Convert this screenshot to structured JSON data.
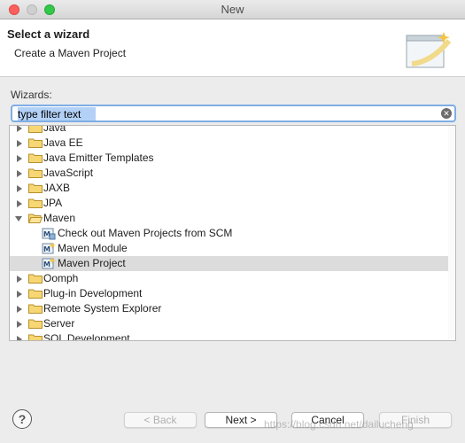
{
  "window": {
    "title": "New"
  },
  "header": {
    "title": "Select a wizard",
    "description": "Create a Maven Project"
  },
  "wizards": {
    "label": "Wizards:",
    "filter_value": "type filter text"
  },
  "tree": {
    "items": [
      {
        "label": "Java",
        "state": "collapsed",
        "kind": "folder"
      },
      {
        "label": "Java EE",
        "state": "collapsed",
        "kind": "folder"
      },
      {
        "label": "Java Emitter Templates",
        "state": "collapsed",
        "kind": "folder"
      },
      {
        "label": "JavaScript",
        "state": "collapsed",
        "kind": "folder"
      },
      {
        "label": "JAXB",
        "state": "collapsed",
        "kind": "folder"
      },
      {
        "label": "JPA",
        "state": "collapsed",
        "kind": "folder"
      },
      {
        "label": "Maven",
        "state": "expanded",
        "kind": "folder"
      },
      {
        "label": "Check out Maven Projects from SCM",
        "kind": "maven-checkout"
      },
      {
        "label": "Maven Module",
        "kind": "maven-module"
      },
      {
        "label": "Maven Project",
        "kind": "maven-project",
        "selected": true
      },
      {
        "label": "Oomph",
        "state": "collapsed",
        "kind": "folder"
      },
      {
        "label": "Plug-in Development",
        "state": "collapsed",
        "kind": "folder"
      },
      {
        "label": "Remote System Explorer",
        "state": "collapsed",
        "kind": "folder"
      },
      {
        "label": "Server",
        "state": "collapsed",
        "kind": "folder"
      },
      {
        "label": "SQL Development",
        "state": "collapsed",
        "kind": "folder"
      }
    ]
  },
  "buttons": {
    "help": "?",
    "back": "< Back",
    "next": "Next >",
    "cancel": "Cancel",
    "finish": "Finish"
  },
  "watermark": "https://blog.csdn.net/dailucheng",
  "colors": {
    "selection": "#dcdcdc",
    "focus_ring": "#7eaee4",
    "folder": "#f2c94c"
  }
}
